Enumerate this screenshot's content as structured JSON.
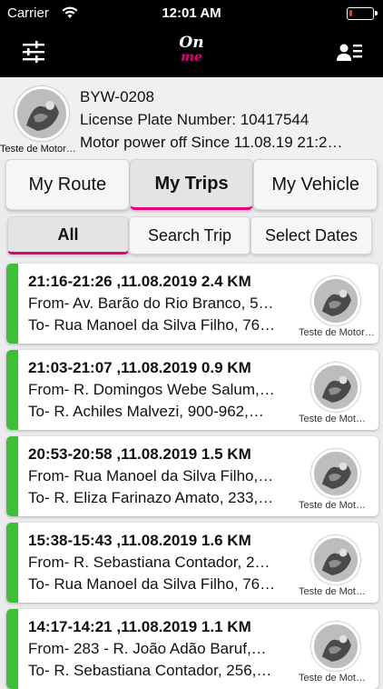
{
  "status_bar": {
    "carrier": "Carrier",
    "time": "12:01 AM"
  },
  "nav": {
    "logo_top": "On",
    "logo_bottom": "me",
    "left_icon": "sliders-icon",
    "right_icon": "contact-card-icon"
  },
  "vehicle": {
    "avatar_caption": "Teste de Motor…",
    "plate": "BYW-0208",
    "license_line": "License Plate Number: 10417544",
    "power_line": "Motor power off Since 11.08.19 21:2…"
  },
  "tabs": [
    {
      "label": "My Route",
      "active": false
    },
    {
      "label": "My Trips",
      "active": true
    },
    {
      "label": "My Vehicle",
      "active": false
    }
  ],
  "subtabs": [
    {
      "label": "All",
      "active": true
    },
    {
      "label": "Search Trip",
      "active": false
    },
    {
      "label": "Select Dates",
      "active": false
    }
  ],
  "trips": [
    {
      "header": "21:16-21:26 ,11.08.2019  2.4 KM",
      "from": "From- Av. Barão do Rio Branco, 5…",
      "to": "To- Rua Manoel da Silva Filho, 76…",
      "caption": "Teste de Motor…"
    },
    {
      "header": "21:03-21:07 ,11.08.2019  0.9 KM",
      "from": "From- R. Domingos Webe Salum,…",
      "to": "To- R. Achiles Malvezi, 900-962,…",
      "caption": "Teste de Mot…"
    },
    {
      "header": "20:53-20:58 ,11.08.2019  1.5 KM",
      "from": "From- Rua Manoel da Silva Filho,…",
      "to": "To- R. Eliza Farinazo Amato, 233,…",
      "caption": "Teste de Mot…"
    },
    {
      "header": "15:38-15:43 ,11.08.2019  1.6 KM",
      "from": "From- R. Sebastiana Contador, 2…",
      "to": "To- Rua Manoel da Silva Filho, 76…",
      "caption": "Teste de Mot…"
    },
    {
      "header": "14:17-14:21 ,11.08.2019  1.1 KM",
      "from": "From- 283 - R. João Adão Baruf,…",
      "to": "To- R. Sebastiana Contador, 256,…",
      "caption": "Teste de Mot…"
    }
  ],
  "colors": {
    "accent": "#e6007e",
    "trip_bar": "#3dbf3a",
    "header_bg": "#000000"
  }
}
